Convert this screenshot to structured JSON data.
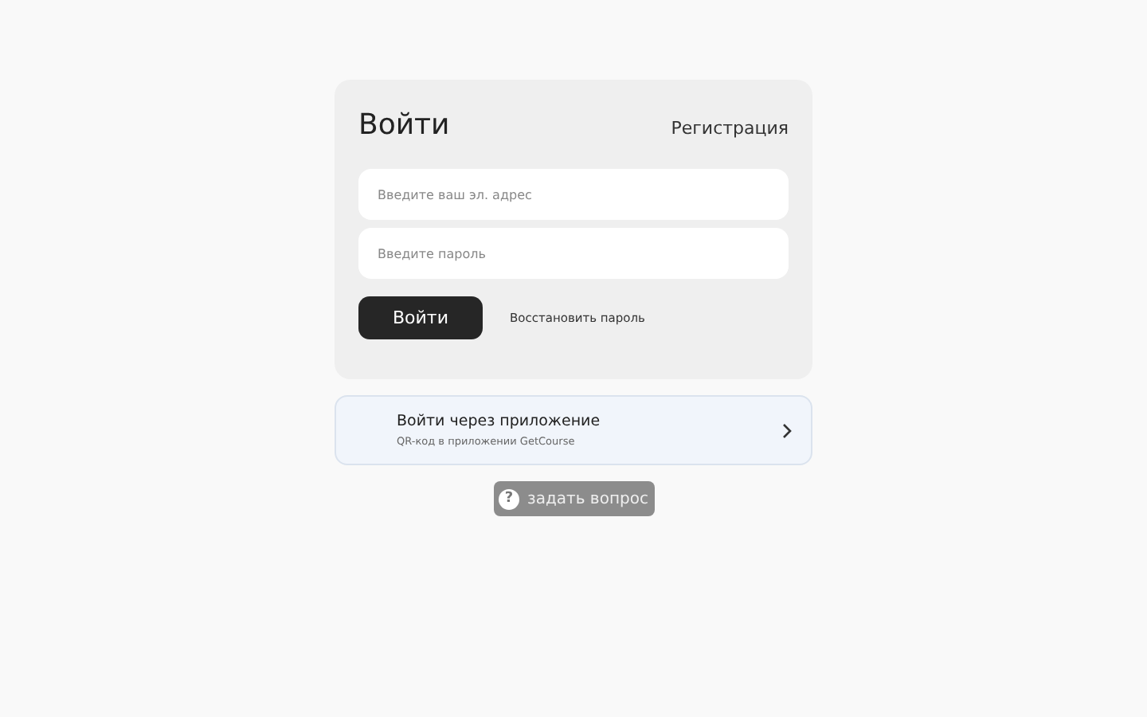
{
  "login": {
    "title": "Войти",
    "register_link": "Регистрация",
    "email_field": {
      "placeholder": "Введите ваш эл. адрес"
    },
    "password_field": {
      "placeholder": "Введите пароль"
    },
    "submit_button": "Войти",
    "restore_link": "Восстановить пароль"
  },
  "app_login": {
    "title": "Войти через приложение",
    "subtitle": "QR-код в приложении GetCourse"
  },
  "help_button": {
    "icon": "?",
    "label": "задать вопрос"
  }
}
